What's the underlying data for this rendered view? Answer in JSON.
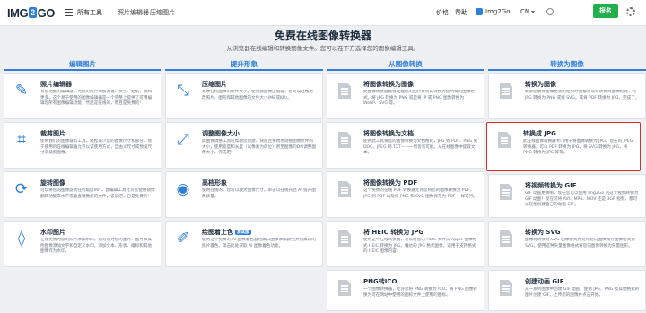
{
  "header": {
    "logo_a": "IMG",
    "logo_b": "2",
    "logo_c": "GO",
    "all_tools": "所有工具",
    "nav_links": [
      "照片编辑器",
      "压缩图片"
    ],
    "pricing": "价格",
    "help": "帮助",
    "brand": "Img2Go",
    "lang": "CN",
    "register": "报名"
  },
  "hero": {
    "title": "免费在线图像转换器",
    "subtitle": "从浏览器在线编辑和转换图像文件。您可以在下方选择您的图像编辑工具。"
  },
  "columns": [
    {
      "heading": "编辑图片",
      "cards": [
        {
          "title": "照片编辑器",
          "icon": "magic-wand-icon",
          "desc": "有限功能的编辑器，为您的照片添加滤镜、文字、贴纸、帧和更多。这个易于使用的图像编辑器是一个完整上提供了可用编辑您所有图像编辑功能，然后是在线的，而且是免费的!"
        },
        {
          "title": "裁剪图片",
          "icon": "crop-icon",
          "desc": "使用我们的图像裁剪工具，轻松减少您的图像尺寸和部分，易于使用的在线编辑器允许以该使用方式，自由义尺寸或预设尺寸来裁剪图像。"
        },
        {
          "title": "旋转图像",
          "icon": "rotate-icon",
          "desc": "可以将您的图像旋转任何角度90°，此编辑工具允许您使用镜像翻转功能来水平或垂直镜像您的文件，该说吧，已是免费的!"
        },
        {
          "title": "水印图片",
          "icon": "drop-icon",
          "desc": "在线免费为您的照片添加水印，您可以为您的图片、图片和其他图像添加文字和自定义水印。添加文本、形状、徽标和其他图像作为水印。"
        }
      ]
    },
    {
      "heading": "提升形象",
      "cards": [
        {
          "title": "压缩图片",
          "icon": "compress-icon",
          "desc": "更改任何图像的文件大小，使用此图像压缩器，您可以轻松更改照片、图形和其他图像的文件大小(MB或KB)。"
        },
        {
          "title": "调整图像大小",
          "icon": "resize-icon",
          "desc": "此图像调整工具可帮助您创建、快速且免费地调整图像文件的大小，使用宽度和长度（以像素为单位）甚至图像的DPI调整图像大小，完成吧!"
        },
        {
          "title": "高档形象",
          "icon": "eye-icon",
          "desc": "使用在线的，您可以放大图像尺寸。单击以在线开启 AI 提升图像质量。"
        },
        {
          "title": "绘图着上色",
          "badge": "测试版",
          "icon": "paint-brush-icon",
          "desc": "使用这个免费的 AI 图像着色器为黑白图像添加颜色并为黑白的照片着色。单击此处获取 AI 图像着色功能。"
        }
      ]
    },
    {
      "heading": "从图像转换",
      "cards": [
        {
          "title": "将图像转换为图像",
          "icon": "document-icon",
          "desc": "此图像转换器能够处理您的图片并将其转换为您所需的图像格式，将 JPG 转换为 PNG 或是将 JP 或 PNG 图像转换为 WebP、SVG 等。"
        },
        {
          "title": "将图像转换为文档",
          "icon": "document-icon",
          "desc": "使用此工具将您的图像转换为文档格式，JPG 到 PDF、PNG 到 DOC、JPEG 到 TXT——一切皆有可能。从在线图像中提取文本。"
        },
        {
          "title": "将图像转换为 PDF",
          "icon": "document-icon",
          "desc": "这个免费的在线 PDF 转换器允许您将您的图像转换为 PDF，JPG 到 PDF 以及将 PNG 和 SVG 图像保存为 PDF 一样可行。"
        },
        {
          "title": "将 HEIC 转换为 JPG",
          "icon": "document-icon",
          "desc": "使用这个在线转换器，可以将您的 HEIC 文件从 Apple 图像格式 HEIC 转换为 JPG。懂达的 JPG 格式图像，适用于支持格式的 HEIC 图像内容。"
        },
        {
          "title": "PNG转ICO",
          "icon": "document-icon",
          "desc": "一个图像转换器，允许您将 PNG 转换为 ICO。将 PNG 图像转换为可在网站中使用的图标文件上使用的图标。"
        }
      ]
    },
    {
      "heading": "转换为图像",
      "cards": [
        {
          "title": "转换为图像",
          "icon": "document-icon",
          "desc": "如果您需要图像格式的结果时我都可以将转换为图像格式，将 JPG 转换为 PNG 或将 SVG，或将 PDF 转换为 JPG，完成了。"
        },
        {
          "title": "转换成 JPG",
          "icon": "document-icon",
          "highlight": true,
          "desc": "此在线图像转换器专门用于将图像转换为 JPG。现在的 JPEG 转换器，可以 PDF 转换为 JPG，将 SVG 转换为 JPG，将 PNG 转换为 JPG 等等。"
        },
        {
          "title": "将视频转换为 GIF",
          "icon": "document-icon",
          "desc": "GIF 动画更清晰，现在您可以使用 Img2Go 的这个视频转换为 GIF 动图！现在可将 AVI、MP4、MOV 还是 3GP 视频，都可以轻松创建自己的动画 GIF。"
        },
        {
          "title": "转换为 SVG",
          "icon": "document-icon",
          "desc": "图像将转换为 SVG 图像格式并允许您向图像保存图像格式为 SVG。使用这种矢量图像格式将您向图像转换为矢量图形。"
        },
        {
          "title": "创建动画 GIF",
          "icon": "document-icon",
          "desc": "从一系列图像中创建 GIF 动画，使用 JPG、PNG 及其他格式的图片创建 GIF，上传您的图像并点击开始。"
        }
      ]
    }
  ]
}
